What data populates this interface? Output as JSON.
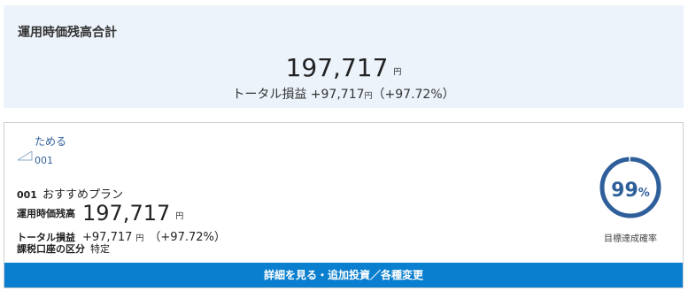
{
  "summary": {
    "title": "運用時価残高合計",
    "total_value": "197,717",
    "currency": "円",
    "gain_label": "トータル損益",
    "gain_value": "+97,717",
    "gain_pct": "（+97.72%）"
  },
  "fund_card": {
    "brand_link": "ためる",
    "code_link": "001",
    "plan_code": "001",
    "plan_name": "おすすめプラン",
    "value_label": "運用時価残高",
    "value": "197,717",
    "gain_label": "トータル損益",
    "gain_value": "+97,717",
    "gain_pct": "（+97.72%）",
    "tax_label": "課税口座の区分",
    "tax_value": "特定",
    "currency": "円",
    "gauge": {
      "value": "99",
      "unit": "%",
      "fraction": 0.99,
      "label": "目標達成確率",
      "color": "#2f5f9a"
    },
    "detail_button_label": "詳細を見る・追加投資／各種変更"
  },
  "colors": {
    "summary_bg": "#ecf3fb",
    "link": "#2f5f9a",
    "button": "#0a7fcf"
  }
}
